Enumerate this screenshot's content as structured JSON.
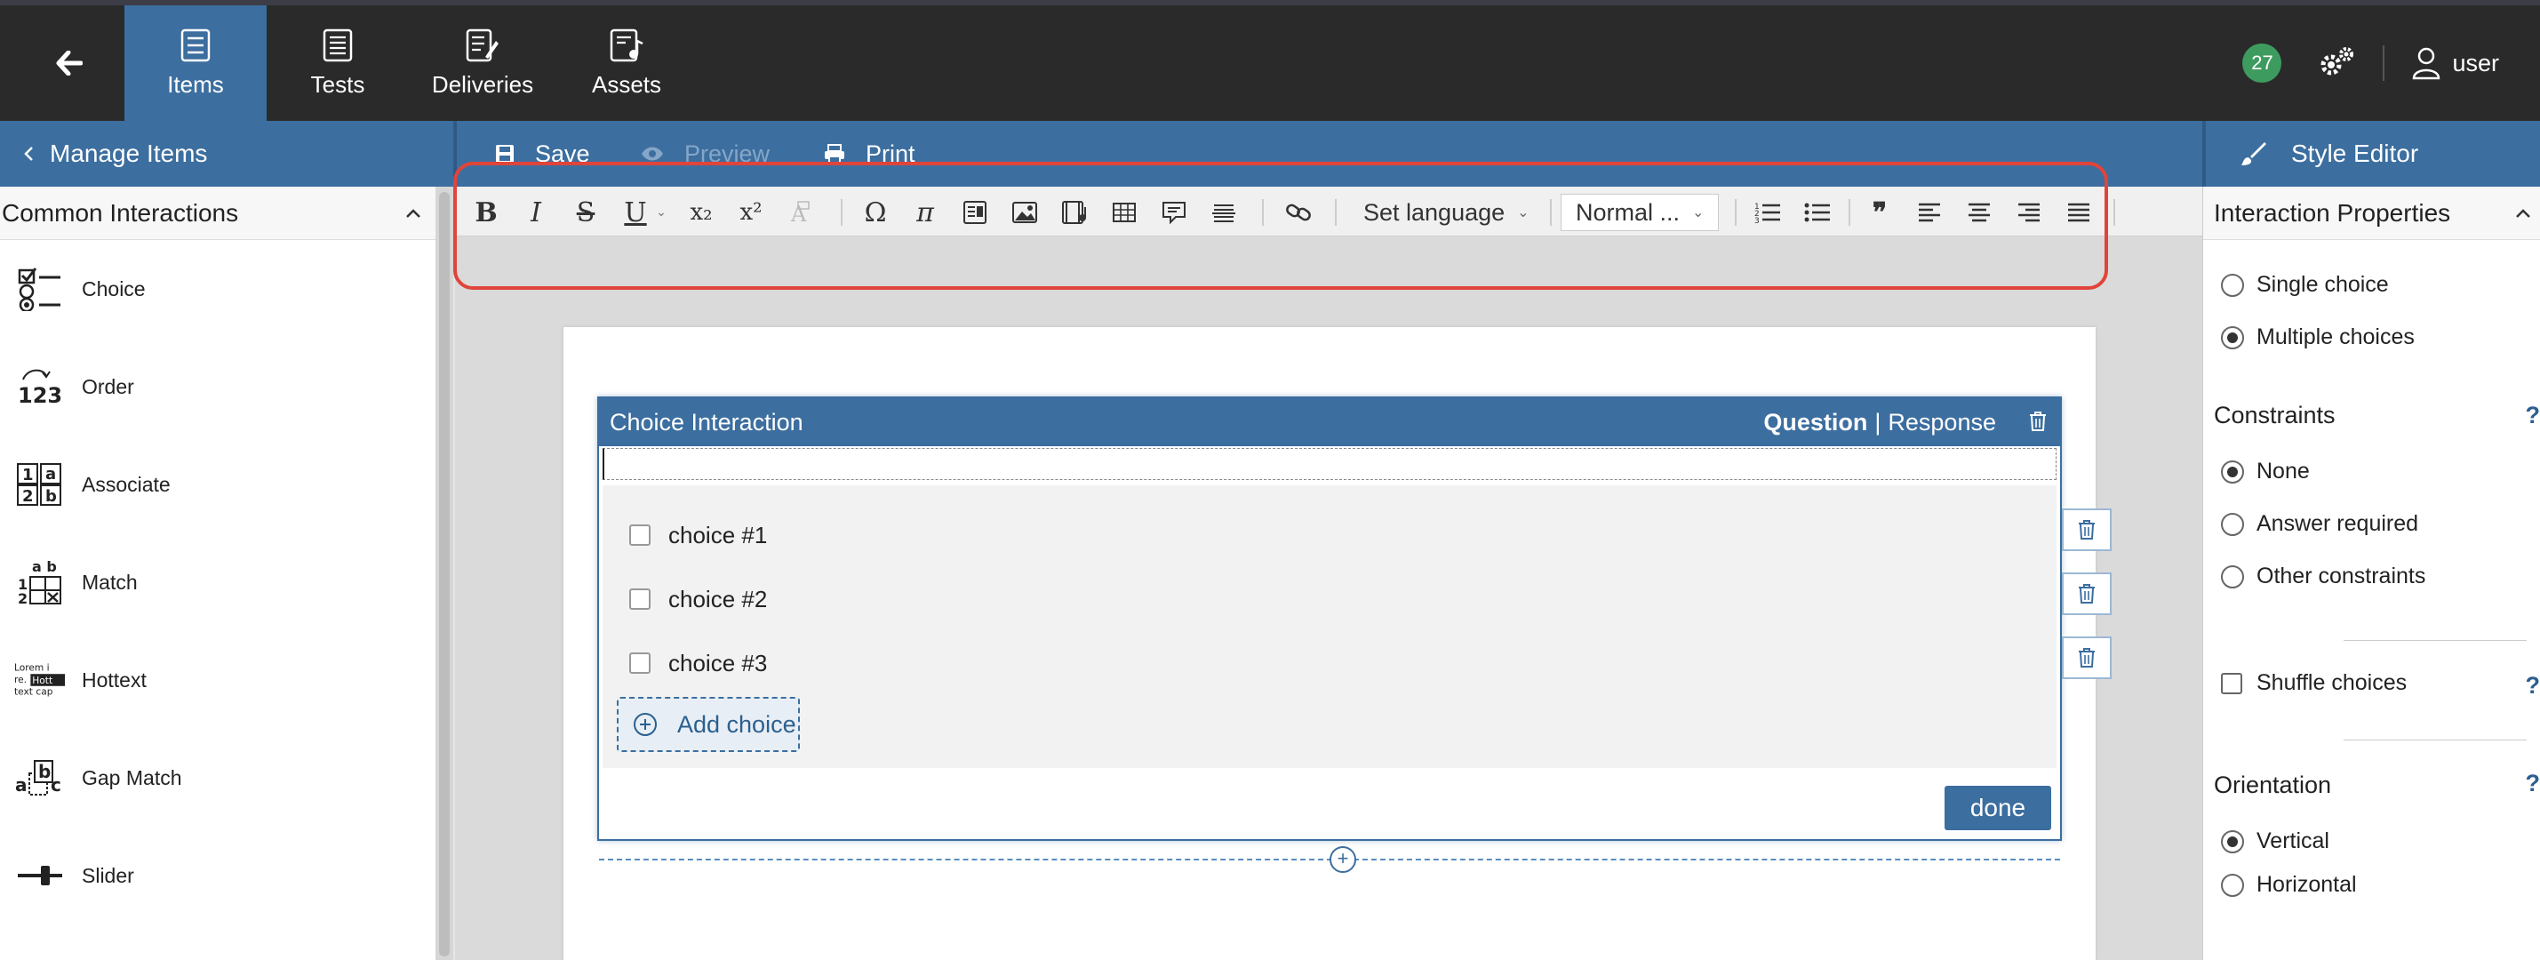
{
  "nav": {
    "tabs": [
      {
        "label": "Items",
        "icon": "items-icon",
        "active": true
      },
      {
        "label": "Tests",
        "icon": "tests-icon"
      },
      {
        "label": "Deliveries",
        "icon": "deliveries-icon"
      },
      {
        "label": "Assets",
        "icon": "assets-icon"
      }
    ],
    "badge_count": "27",
    "user_label": "user"
  },
  "subbar": {
    "manage_items": "Manage Items",
    "save": "Save",
    "preview": "Preview",
    "print": "Print",
    "style_editor": "Style Editor"
  },
  "left_panel": {
    "header": "Common Interactions",
    "items": [
      {
        "label": "Choice",
        "icon": "choice-icon"
      },
      {
        "label": "Order",
        "icon": "order-icon"
      },
      {
        "label": "Associate",
        "icon": "associate-icon"
      },
      {
        "label": "Match",
        "icon": "match-icon"
      },
      {
        "label": "Hottext",
        "icon": "hottext-icon"
      },
      {
        "label": "Gap Match",
        "icon": "gap-match-icon"
      },
      {
        "label": "Slider",
        "icon": "slider-icon"
      }
    ],
    "icon_text": {
      "order": "123",
      "associate_a": "1 a",
      "associate_b": "2 b",
      "hottext_1": "Lorem i",
      "hottext_2": "re",
      "hottext_3": "Hott",
      "hottext_4": "text cap",
      "gap_a": "a",
      "gap_b": "b",
      "gap_c": "c"
    }
  },
  "toolbar": {
    "set_language": "Set language",
    "format": "Normal ...",
    "bold": "B",
    "italic": "I",
    "strike": "S",
    "underline": "U",
    "subscript": "x₂",
    "superscript": "x²",
    "omega": "Ω",
    "pi": "π",
    "blockquote": "❞"
  },
  "interaction": {
    "title": "Choice Interaction",
    "mode_question": "Question",
    "mode_separator": "|",
    "mode_response": "Response",
    "choices": [
      "choice #1",
      "choice #2",
      "choice #3"
    ],
    "add_choice": "Add choice",
    "done": "done",
    "insert_plus": "+"
  },
  "right_panel": {
    "header": "Interaction Properties",
    "type_single": "Single choice",
    "type_multiple": "Multiple choices",
    "constraints_label": "Constraints",
    "constraint_none": "None",
    "constraint_required": "Answer required",
    "constraint_other": "Other constraints",
    "shuffle": "Shuffle choices",
    "orientation_label": "Orientation",
    "orientation_vertical": "Vertical",
    "orientation_horizontal": "Horizontal",
    "help_mark": "?"
  },
  "colors": {
    "nav_bg": "#2a2a2a",
    "accent": "#3c6e9f",
    "highlight": "#e0443a",
    "badge": "#3e9b5f"
  }
}
